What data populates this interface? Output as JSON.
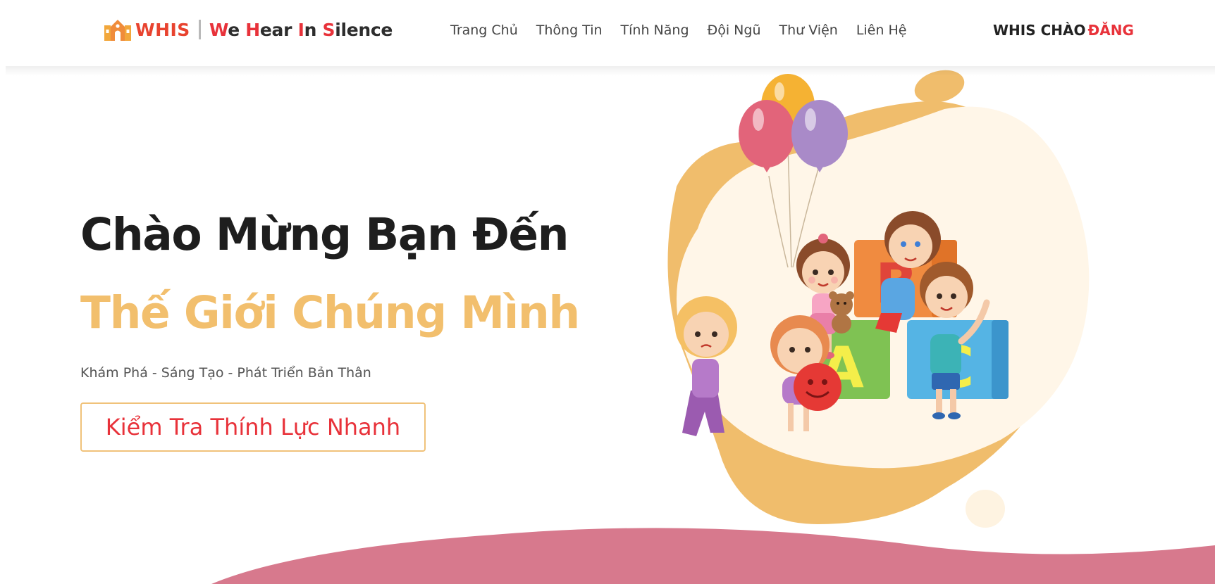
{
  "header": {
    "logo_brand": "WHIS",
    "logo_tagline_parts": [
      "W",
      "e ",
      "H",
      "ear ",
      "I",
      "n ",
      "S",
      "ilence"
    ],
    "nav": [
      "Trang Chủ",
      "Thông Tin",
      "Tính Năng",
      "Đội Ngũ",
      "Thư Viện",
      "Liên Hệ"
    ],
    "greeting_prefix": "WHIS CHÀO",
    "greeting_user": "ĐĂNG"
  },
  "hero": {
    "title": "Chào Mừng Bạn Đến",
    "subtitle": "Thế Giới Chúng Mình",
    "tagline": "Khám Phá - Sáng Tạo - Phát Triển Bản Thân",
    "cta_label": "Kiểm Tra Thính Lực Nhanh"
  },
  "illustration": {
    "blocks": [
      "A",
      "B",
      "C"
    ],
    "icon": "children-with-abc-blocks-and-balloons-illustration"
  },
  "colors": {
    "brand_red": "#e8323a",
    "accent_yellow": "#f2bf6d",
    "wave_pink": "#d7798d",
    "blob_cream": "#fff7e9"
  }
}
